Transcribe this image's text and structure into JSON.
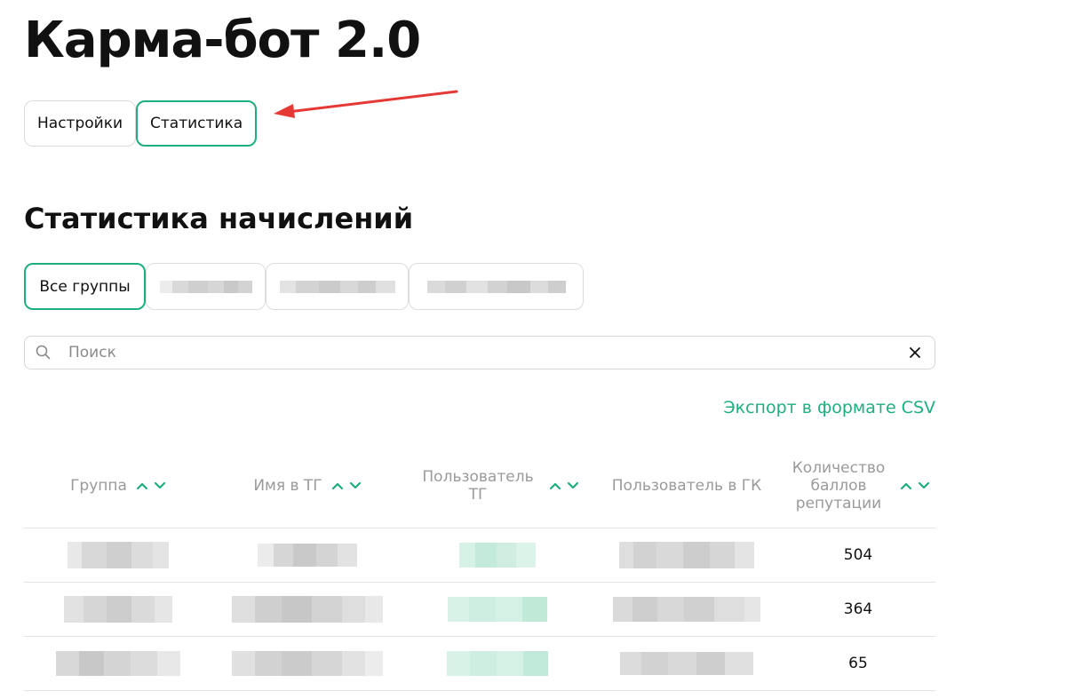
{
  "app": {
    "title": "Карма-бот 2.0"
  },
  "tabs": [
    {
      "label": "Настройки",
      "active": false
    },
    {
      "label": "Статистика",
      "active": true
    }
  ],
  "section": {
    "title": "Статистика начислений"
  },
  "group_filters": [
    {
      "label": "Все группы",
      "active": true
    },
    {
      "label": "",
      "redacted": true
    },
    {
      "label": "",
      "redacted": true
    },
    {
      "label": "",
      "redacted": true
    }
  ],
  "search": {
    "placeholder": "Поиск",
    "value": "",
    "icon": "search-icon",
    "clear_icon": "close-icon"
  },
  "export": {
    "label": "Экспорт в формате CSV"
  },
  "table": {
    "columns": [
      {
        "label": "Группа",
        "sortable": true
      },
      {
        "label": "Имя в ТГ",
        "sortable": true
      },
      {
        "label": "Пользователь ТГ",
        "sortable": true
      },
      {
        "label": "Пользователь в ГК",
        "sortable": false
      },
      {
        "label": "Количество баллов репутации",
        "sortable": true
      }
    ],
    "rows": [
      {
        "group": "",
        "tg_name": "",
        "tg_user": "",
        "gk_user": "",
        "reputation": "504"
      },
      {
        "group": "",
        "tg_name": "",
        "tg_user": "",
        "gk_user": "",
        "reputation": "364"
      },
      {
        "group": "",
        "tg_name": "",
        "tg_user": "",
        "gk_user": "",
        "reputation": "65"
      }
    ]
  },
  "colors": {
    "accent": "#1fae7e",
    "annotation_arrow": "#e53935",
    "border": "#dcdcdc",
    "muted_text": "#9a9a9a"
  }
}
